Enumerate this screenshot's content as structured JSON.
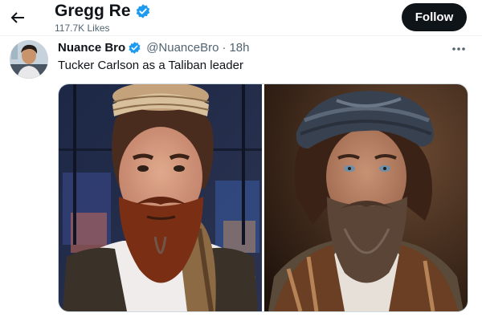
{
  "header": {
    "profile_name": "Gregg Re",
    "likes": "117.7K Likes",
    "follow_label": "Follow"
  },
  "tweet": {
    "author_name": "Nuance Bro",
    "handle": "@NuanceBro",
    "separator": "·",
    "timestamp": "18h",
    "text": "Tucker Carlson as a Taliban leader"
  },
  "media": [
    {
      "description": "AI image: bearded man in a tan patterned turban and scarf with a blurred city-night backdrop"
    },
    {
      "description": "AI image: bearded man with a dark wrapped turban and patterned scarf against a dim brown background"
    }
  ],
  "icons": {
    "back": "back-arrow-icon",
    "verified": "verified-badge-icon",
    "more": "more-options-icon"
  },
  "colors": {
    "text_primary": "#0f1419",
    "text_secondary": "#536471",
    "verified": "#1d9bf0",
    "follow_bg": "#0f1419"
  }
}
